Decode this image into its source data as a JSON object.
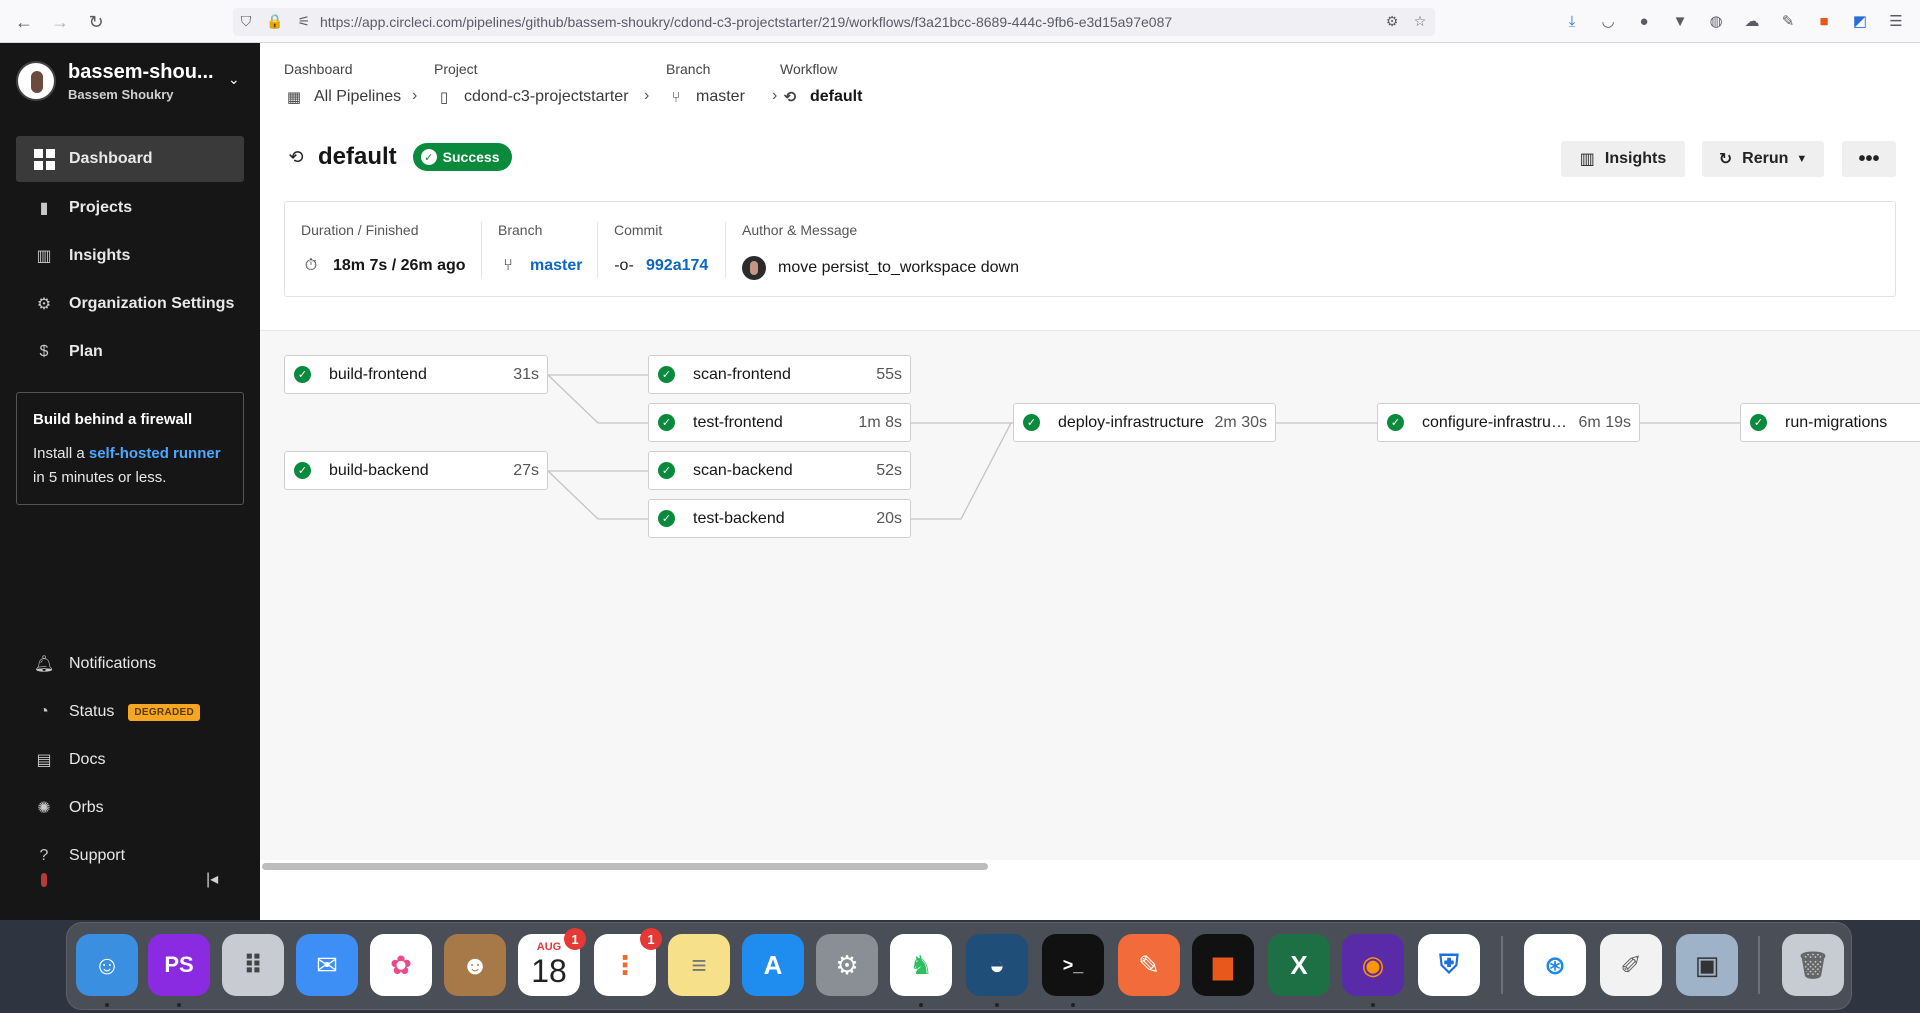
{
  "browser": {
    "url": "https://app.circleci.com/pipelines/github/bassem-shoukry/cdond-c3-projectstarter/219/workflows/f3a21bcc-8689-444c-9fb6-e3d15a97e087"
  },
  "sidebar": {
    "org_name": "bassem-shou...",
    "user_name": "Bassem Shoukry",
    "items": [
      {
        "label": "Dashboard",
        "icon": "dashboard-icon"
      },
      {
        "label": "Projects",
        "icon": "projects-icon"
      },
      {
        "label": "Insights",
        "icon": "insights-icon"
      },
      {
        "label": "Organization Settings",
        "icon": "gear-icon"
      },
      {
        "label": "Plan",
        "icon": "dollar-icon"
      }
    ],
    "promo": {
      "title": "Build behind a firewall",
      "text_before": "Install a ",
      "link": "self-hosted runner",
      "text_after": "in 5 minutes or less."
    },
    "bottom_items": [
      {
        "label": "Notifications",
        "icon": "bell-icon"
      },
      {
        "label": "Status",
        "icon": "status-icon",
        "badge": "DEGRADED"
      },
      {
        "label": "Docs",
        "icon": "docs-icon"
      },
      {
        "label": "Orbs",
        "icon": "orbs-icon"
      },
      {
        "label": "Support",
        "icon": "help-icon"
      }
    ]
  },
  "breadcrumbs": {
    "dashboard": {
      "title": "Dashboard",
      "value": "All Pipelines"
    },
    "project": {
      "title": "Project",
      "value": "cdond-c3-projectstarter"
    },
    "branch": {
      "title": "Branch",
      "value": "master"
    },
    "workflow": {
      "title": "Workflow",
      "value": "default"
    }
  },
  "header": {
    "title": "default",
    "status": "Success",
    "insights_label": "Insights",
    "rerun_label": "Rerun"
  },
  "summary": {
    "duration_label": "Duration / Finished",
    "duration_value": "18m 7s / 26m ago",
    "branch_label": "Branch",
    "branch_value": "master",
    "commit_label": "Commit",
    "commit_value": "992a174",
    "author_label": "Author & Message",
    "message": "move persist_to_workspace down"
  },
  "jobs": {
    "build_frontend": {
      "name": "build-frontend",
      "duration": "31s"
    },
    "build_backend": {
      "name": "build-backend",
      "duration": "27s"
    },
    "scan_frontend": {
      "name": "scan-frontend",
      "duration": "55s"
    },
    "test_frontend": {
      "name": "test-frontend",
      "duration": "1m 8s"
    },
    "scan_backend": {
      "name": "scan-backend",
      "duration": "52s"
    },
    "test_backend": {
      "name": "test-backend",
      "duration": "20s"
    },
    "deploy_infrastructure": {
      "name": "deploy-infrastructure",
      "duration": "2m 30s"
    },
    "configure_infrastructure": {
      "name": "configure-infrastructu…",
      "duration": "6m 19s"
    },
    "run_migrations": {
      "name": "run-migrations",
      "duration": ""
    }
  },
  "dock": {
    "calendar_month": "AUG",
    "calendar_day": "18",
    "calendar_badge": "1",
    "reminders_badge": "1",
    "phpstorm_label": "PS"
  },
  "colors": {
    "success": "#0a8a3c",
    "link": "#0a67c2",
    "sidebar_bg": "#161616",
    "degraded": "#f5a623"
  }
}
